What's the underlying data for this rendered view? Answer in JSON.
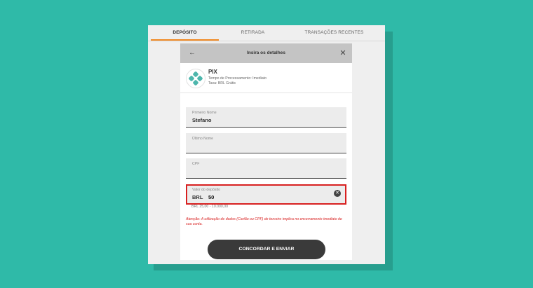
{
  "tabs": [
    {
      "label": "DEPÓSITO"
    },
    {
      "label": "RETIRADA"
    },
    {
      "label": "TRANSAÇÕES RECENTES"
    }
  ],
  "modal": {
    "title": "Insira os detalhes",
    "back_icon": "arrow-left-icon",
    "close_icon": "close-icon"
  },
  "method": {
    "name": "PIX",
    "processing": "Tempo de Processamento: Imediato",
    "fee": "Taxa: BRL Grátis",
    "logo": "pix-logo"
  },
  "fields": {
    "first_name": {
      "label": "Primeiro Nome",
      "value": "Stefano"
    },
    "last_name": {
      "label": "Último Nome",
      "value": ""
    },
    "cpf": {
      "label": "CPF",
      "value": ""
    },
    "deposit": {
      "label": "Valor do depósito",
      "currency": "BRL",
      "value": "50"
    }
  },
  "deposit_range": "BRL 25,00 - 10.000,00",
  "warning": "Atenção: A utilização de dados (Cartão ou CPF) de terceiro implica no encerramento imediato de sua conta.",
  "submit_label": "CONCORDAR E ENVIAR",
  "colors": {
    "background": "#2fbaa8",
    "accent": "#f08a24",
    "error": "#d82020",
    "button": "#3a3a3a"
  }
}
